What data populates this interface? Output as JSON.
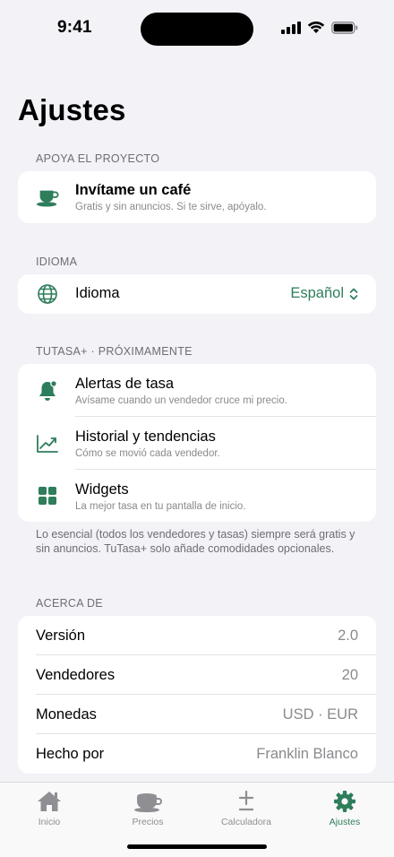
{
  "status_bar": {
    "time": "9:41"
  },
  "page": {
    "title": "Ajustes"
  },
  "support": {
    "header": "APOYA EL PROYECTO",
    "coffee": {
      "title": "Invítame un café",
      "subtitle": "Gratis y sin anuncios. Si te sirve, apóyalo.",
      "icon": "coffee-cup-icon"
    }
  },
  "language": {
    "header": "IDIOMA",
    "row": {
      "title": "Idioma",
      "value": "Español",
      "icon": "globe-icon"
    }
  },
  "plus": {
    "header": "TUTASA+ · PRÓXIMAMENTE",
    "items": [
      {
        "title": "Alertas de tasa",
        "subtitle": "Avísame cuando un vendedor cruce mi precio.",
        "icon": "bell-icon"
      },
      {
        "title": "Historial y tendencias",
        "subtitle": "Cómo se movió cada vendedor.",
        "icon": "trend-chart-icon"
      },
      {
        "title": "Widgets",
        "subtitle": "La mejor tasa en tu pantalla de inicio.",
        "icon": "widgets-grid-icon"
      }
    ],
    "footnote": "Lo esencial (todos los vendedores y tasas) siempre será gratis y sin anuncios. TuTasa+ solo añade comodidades opcionales."
  },
  "about": {
    "header": "ACERCA DE",
    "rows": [
      {
        "label": "Versión",
        "value": "2.0"
      },
      {
        "label": "Vendedores",
        "value": "20"
      },
      {
        "label": "Monedas",
        "value": "USD · EUR"
      },
      {
        "label": "Hecho por",
        "value": "Franklin Blanco"
      }
    ]
  },
  "tab_bar": {
    "tabs": [
      {
        "label": "Inicio",
        "icon": "house-icon",
        "active": false
      },
      {
        "label": "Precios",
        "icon": "coffee-cup-icon",
        "active": false
      },
      {
        "label": "Calculadora",
        "icon": "plus-minus-icon",
        "active": false
      },
      {
        "label": "Ajustes",
        "icon": "gear-icon",
        "active": true
      }
    ]
  },
  "colors": {
    "accent": "#2e7d5b",
    "background": "#f2f2f7",
    "card": "#ffffff",
    "secondary_text": "#8a8a8e"
  }
}
